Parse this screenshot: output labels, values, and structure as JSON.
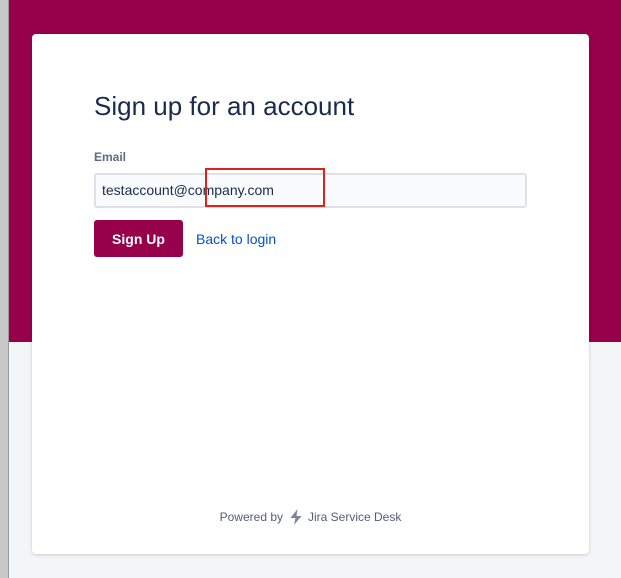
{
  "form": {
    "title": "Sign up for an account",
    "email_label": "Email",
    "email_value": "testaccount@company.com",
    "signup_label": "Sign Up",
    "back_label": "Back to login"
  },
  "footer": {
    "powered_by": "Powered by",
    "product": "Jira Service Desk",
    "icon": "jira-lightning-icon"
  },
  "colors": {
    "brand": "#97004b",
    "link": "#0052cc",
    "highlight": "#e0201d",
    "background": "#f4f5f7"
  }
}
